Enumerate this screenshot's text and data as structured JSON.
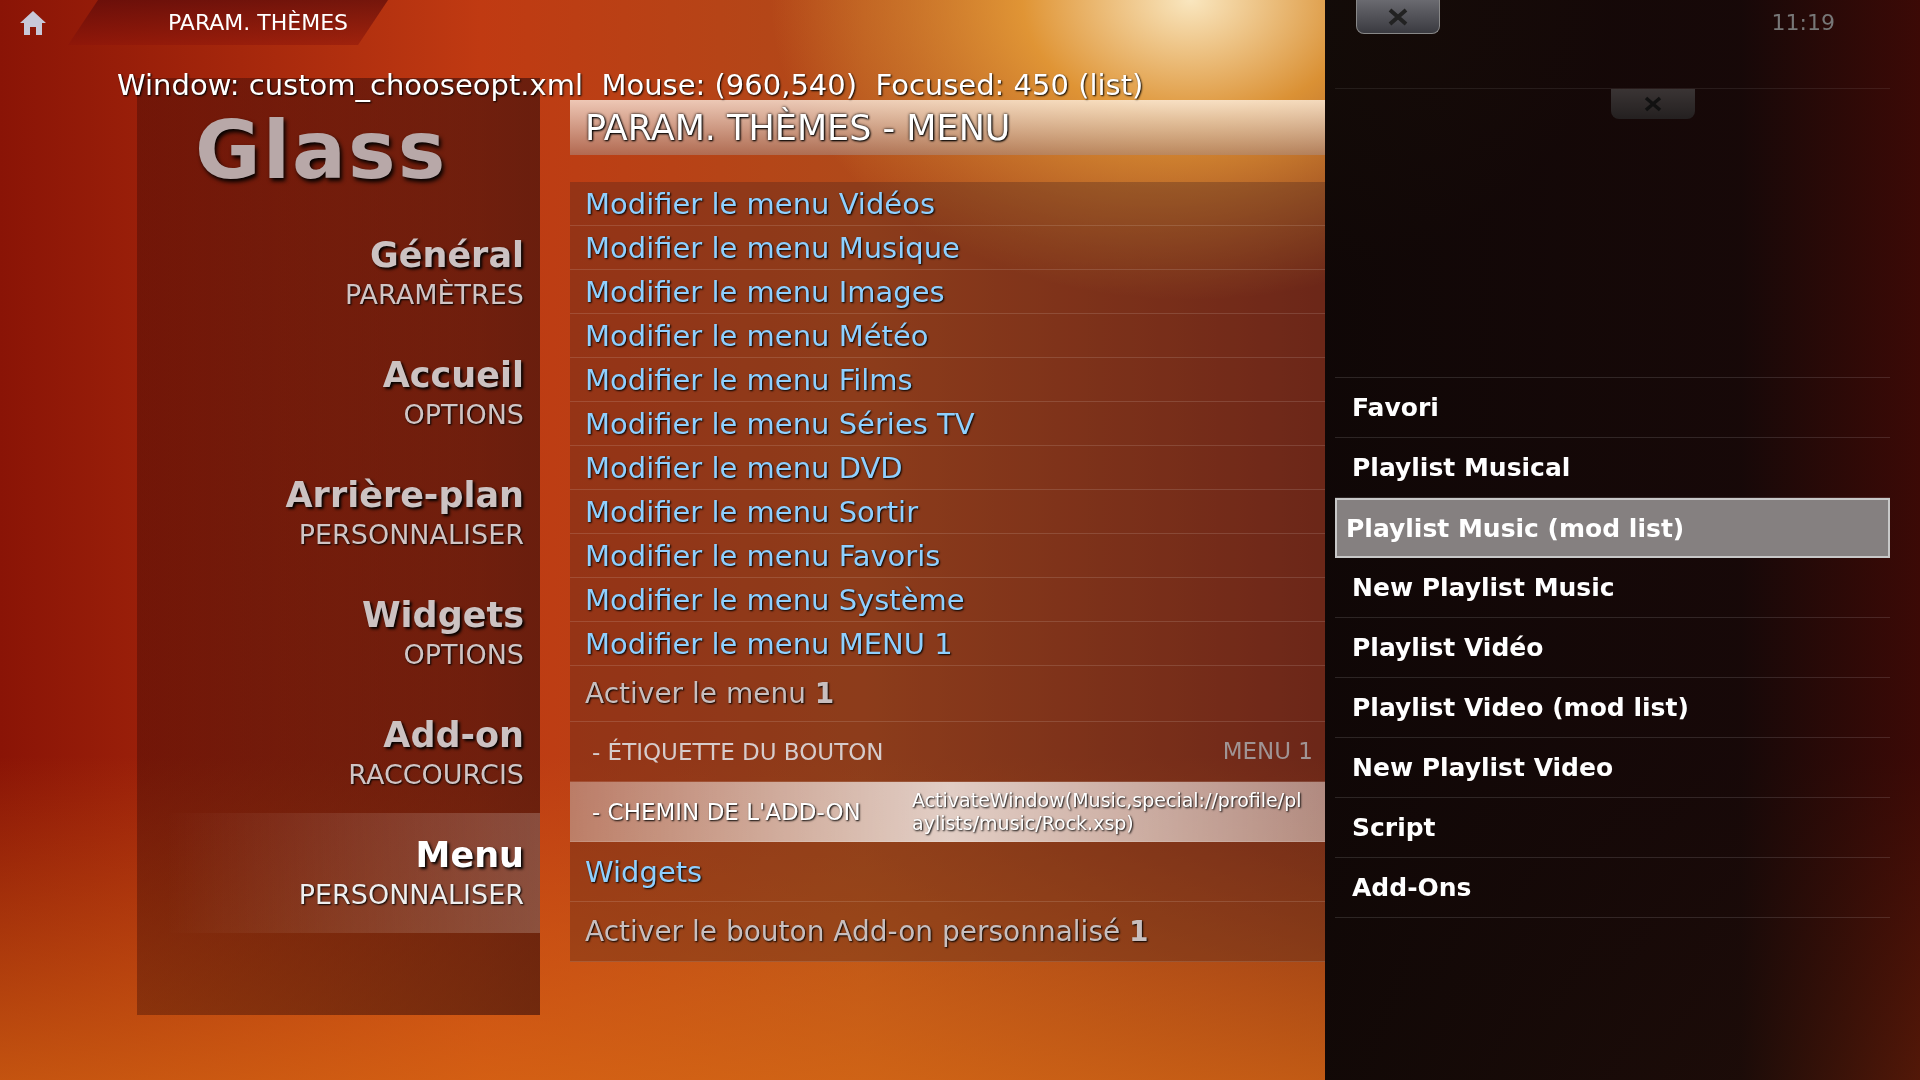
{
  "top_bar": {
    "title": "PARAM. THÈMES",
    "clock": "11:19"
  },
  "debug_info": "Window: custom_chooseopt.xml  Mouse: (960,540)  Focused: 450 (list)",
  "logo": "Glass",
  "categories": [
    {
      "title": "Général",
      "subtitle": "PARAMÈTRES",
      "selected": false
    },
    {
      "title": "Accueil",
      "subtitle": "OPTIONS",
      "selected": false
    },
    {
      "title": "Arrière-plan",
      "subtitle": "PERSONNALISER",
      "selected": false
    },
    {
      "title": "Widgets",
      "subtitle": "OPTIONS",
      "selected": false
    },
    {
      "title": "Add-on",
      "subtitle": "RACCOURCIS",
      "selected": false
    },
    {
      "title": "Menu",
      "subtitle": "PERSONNALISER",
      "selected": true
    }
  ],
  "settings": {
    "heading": "PARAM. THÈMES - MENU",
    "items": [
      {
        "kind": "link",
        "label": "Modifier le menu Vidéos",
        "selected": false
      },
      {
        "kind": "link",
        "label": "Modifier le menu Musique",
        "selected": false
      },
      {
        "kind": "link",
        "label": "Modifier le menu Images",
        "selected": false
      },
      {
        "kind": "link",
        "label": "Modifier le menu Météo",
        "selected": false
      },
      {
        "kind": "link",
        "label": "Modifier le menu Films",
        "selected": false
      },
      {
        "kind": "link",
        "label": "Modifier le menu Séries TV",
        "selected": false
      },
      {
        "kind": "link",
        "label": "Modifier le menu DVD",
        "selected": false
      },
      {
        "kind": "link",
        "label": "Modifier le menu Sortir",
        "selected": false
      },
      {
        "kind": "link",
        "label": "Modifier le menu Favoris",
        "selected": false
      },
      {
        "kind": "link",
        "label": "Modifier le menu Système",
        "selected": false
      },
      {
        "kind": "link",
        "label": "Modifier le menu MENU 1",
        "selected": false
      },
      {
        "kind": "toggle",
        "label": "Activer le menu **1**",
        "selected": false
      },
      {
        "kind": "sub",
        "label": "- ÉTIQUETTE DU BOUTON",
        "value": "MENU 1",
        "selected": false
      },
      {
        "kind": "sub",
        "label": "- CHEMIN DE L'ADD-ON",
        "value": "ActivateWindow(Music,special://profile/playlists/music/Rock.xsp)",
        "selected": true
      },
      {
        "kind": "section",
        "label": "Widgets",
        "selected": false
      },
      {
        "kind": "toggle",
        "label": "Activer le bouton Add-on personnalisé **1**",
        "selected": false
      }
    ]
  },
  "select_dialog": {
    "items": [
      {
        "label": "Favori",
        "selected": false
      },
      {
        "label": "Playlist Musical",
        "selected": false
      },
      {
        "label": "Playlist Music (mod list)",
        "selected": true
      },
      {
        "label": "New Playlist Music",
        "selected": false
      },
      {
        "label": "Playlist Vidéo",
        "selected": false
      },
      {
        "label": "Playlist Video (mod list)",
        "selected": false
      },
      {
        "label": "New Playlist Video",
        "selected": false
      },
      {
        "label": "Script",
        "selected": false
      },
      {
        "label": "Add-Ons",
        "selected": false
      }
    ]
  }
}
